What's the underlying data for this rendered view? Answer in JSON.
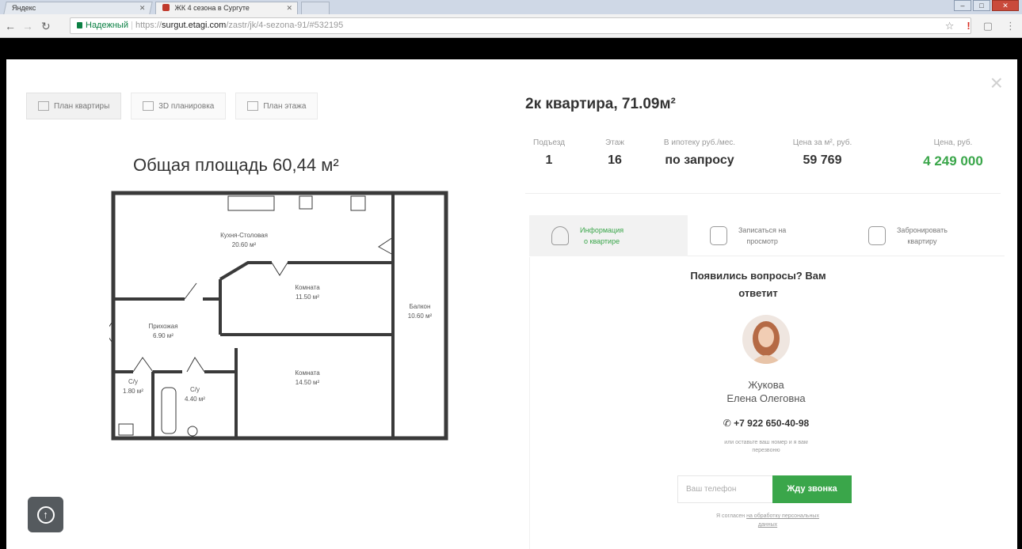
{
  "browser": {
    "tabs": [
      {
        "label": "Яндекс"
      },
      {
        "label": "ЖК 4 сезона в Сургуте"
      }
    ],
    "address": {
      "secure_label": "Надежный",
      "protocol": "https://",
      "host": "surgut.etagi.com",
      "path": "/zastr/jk/4-sezona-91/#532195"
    }
  },
  "plan_view": {
    "tabs": [
      {
        "label": "План квартиры"
      },
      {
        "label": "3D планировка"
      },
      {
        "label": "План этажа"
      }
    ],
    "title": "Общая площадь 60,44 м²",
    "rooms": [
      {
        "name": "Кухня-Столовая",
        "area": "20.60 м²"
      },
      {
        "name": "Комната",
        "area": "11.50 м²"
      },
      {
        "name": "Балкон",
        "area": "10.60 м²"
      },
      {
        "name": "Прихожая",
        "area": "6.90 м²"
      },
      {
        "name": "Комната",
        "area": "14.50 м²"
      },
      {
        "name": "С/у",
        "area": "1.80 м²"
      },
      {
        "name": "С/у",
        "area": "4.40 м²"
      }
    ]
  },
  "apartment": {
    "title": "2к квартира, 71.09м²",
    "stats": [
      {
        "label": "Подъезд",
        "value": "1"
      },
      {
        "label": "Этаж",
        "value": "16"
      },
      {
        "label": "В ипотеку руб./мес.",
        "value": "по запросу"
      },
      {
        "label": "Цена за м², руб.",
        "value": "59 769"
      },
      {
        "label": "Цена, руб.",
        "value": "4 249 000"
      }
    ],
    "price_color": "#3aa64a"
  },
  "actions": {
    "tabs": [
      {
        "line1": "Информация",
        "line2": "о квартире"
      },
      {
        "line1": "Записаться на",
        "line2": "просмотр"
      },
      {
        "line1": "Забронировать",
        "line2": "квартиру"
      }
    ]
  },
  "contact": {
    "question_line1": "Появились вопросы? Вам",
    "question_line2": "ответит",
    "manager_surname": "Жукова",
    "manager_name": "Елена Олеговна",
    "phone": "+7 922 650-40-98",
    "leave_line1": "или оставьте ваш номер и я вам",
    "leave_line2": "перезвоню",
    "input_placeholder": "Ваш телефон",
    "button_label": "Жду звонка",
    "consent_prefix": "Я согласен",
    "consent_link_line1": "на обработку персональных",
    "consent_link_line2": "данных"
  },
  "colors": {
    "accent": "#3aa64a",
    "wall": "#3a3a3a"
  }
}
